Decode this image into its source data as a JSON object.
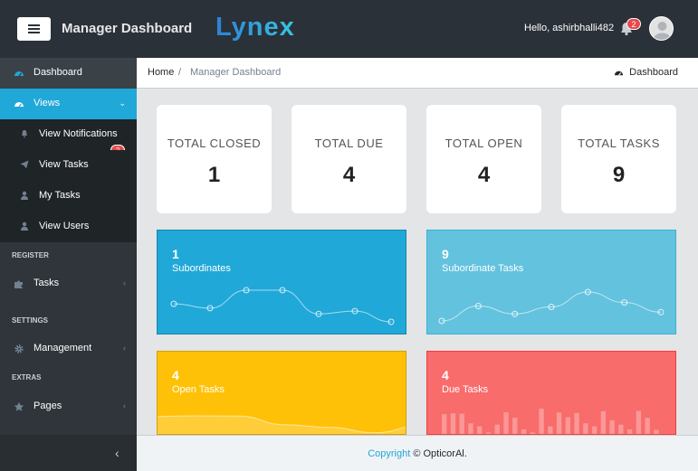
{
  "header": {
    "title": "Manager Dashboard",
    "brand": "Lynex",
    "greeting": "Hello, ashirbhalli482",
    "notification_count": "2",
    "menu_icon": "hamburger-icon",
    "bell_icon": "bell-icon",
    "avatar_icon": "user-avatar-icon"
  },
  "sidebar": {
    "dashboard": {
      "label": "Dashboard",
      "icon": "speedometer-icon"
    },
    "views": {
      "label": "Views",
      "icon": "speedometer-icon",
      "items": [
        {
          "label": "View Notifications",
          "icon": "bell-icon",
          "badge": "2"
        },
        {
          "label": "View Tasks",
          "icon": "paper-plane-icon"
        },
        {
          "label": "My Tasks",
          "icon": "user-icon"
        },
        {
          "label": "View Users",
          "icon": "user-icon"
        }
      ]
    },
    "sections": [
      {
        "title": "REGISTER",
        "item": "Tasks",
        "icon": "puzzle-icon"
      },
      {
        "title": "SETTINGS",
        "item": "Management",
        "icon": "gear-icon"
      },
      {
        "title": "EXTRAS",
        "item": "Pages",
        "icon": "star-icon"
      }
    ],
    "active_color": "#20a8d8"
  },
  "breadcrumb": {
    "home": "Home",
    "separator": "/",
    "current": "Manager Dashboard",
    "right_label": "Dashboard",
    "right_icon": "speedometer-icon"
  },
  "stats": [
    {
      "title": "TOTAL CLOSED",
      "value": "1"
    },
    {
      "title": "TOTAL DUE",
      "value": "4"
    },
    {
      "title": "TOTAL OPEN",
      "value": "4"
    },
    {
      "title": "TOTAL TASKS",
      "value": "9"
    }
  ],
  "widgets": [
    {
      "number": "1",
      "label": "Subordinates",
      "color": "#20a8d8",
      "sparkline": [
        65,
        59,
        84,
        84,
        51,
        55,
        40
      ]
    },
    {
      "number": "9",
      "label": "Subordinate Tasks",
      "color": "#63c2de",
      "sparkline": [
        1,
        18,
        9,
        17,
        34,
        22,
        11
      ]
    },
    {
      "number": "4",
      "label": "Open Tasks",
      "color": "#ffc107",
      "sparkline": [
        78,
        81,
        80,
        45,
        34,
        12,
        40
      ]
    },
    {
      "number": "4",
      "label": "Due Tasks",
      "color": "#f86c6b",
      "bars": [
        78,
        81,
        80,
        45,
        34,
        12,
        40,
        85,
        65,
        23,
        12,
        98,
        34,
        84,
        67,
        82,
        45,
        34,
        89,
        56,
        40,
        23,
        90,
        65,
        21
      ]
    }
  ],
  "footer": {
    "link": "Copyright",
    "rest": "© OpticorAl."
  }
}
